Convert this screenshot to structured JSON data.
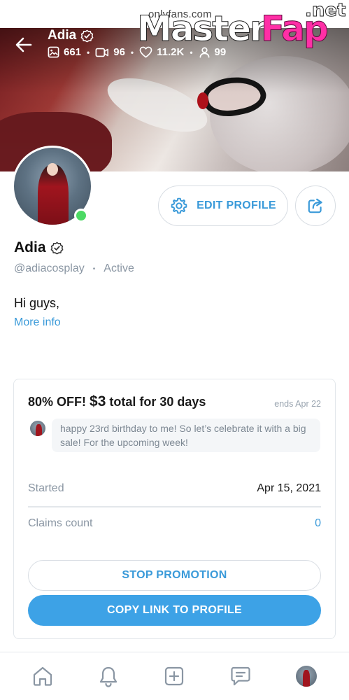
{
  "site": {
    "domain_text": "onlyfans.com"
  },
  "watermark": {
    "word1": "Master",
    "word2": "Fap",
    "suffix": ".net"
  },
  "header": {
    "title": "Adia",
    "stats": {
      "photos": "661",
      "videos": "96",
      "likes": "11.2K",
      "fans": "99"
    }
  },
  "profile": {
    "name": "Adia",
    "handle": "@adiacosplay",
    "status": "Active",
    "bio": "Hi guys,",
    "more_info": "More info",
    "edit_label": "EDIT PROFILE"
  },
  "promo": {
    "headline_prefix": "80% OFF! ",
    "price": "$3",
    "headline_suffix": " total for 30 days",
    "ends": "ends Apr 22",
    "message": "happy 23rd birthday to me! So let’s celebrate it with a big sale! For the upcoming week!",
    "started_label": "Started",
    "started_value": "Apr 15, 2021",
    "claims_label": "Claims count",
    "claims_value": "0",
    "stop_label": "STOP PROMOTION",
    "copy_label": "COPY LINK TO PROFILE"
  },
  "colors": {
    "accent": "#3a9ad9",
    "online": "#4cd964",
    "muted": "#8a96a3"
  },
  "icons": {
    "back": "arrow-left-icon",
    "verified": "verified-badge-icon",
    "photo": "image-icon",
    "video": "video-icon",
    "like": "heart-icon",
    "fans": "user-icon",
    "settings": "gear-icon",
    "share": "share-icon",
    "home": "home-icon",
    "notifications": "bell-icon",
    "add": "plus-square-icon",
    "messages": "chat-icon"
  }
}
